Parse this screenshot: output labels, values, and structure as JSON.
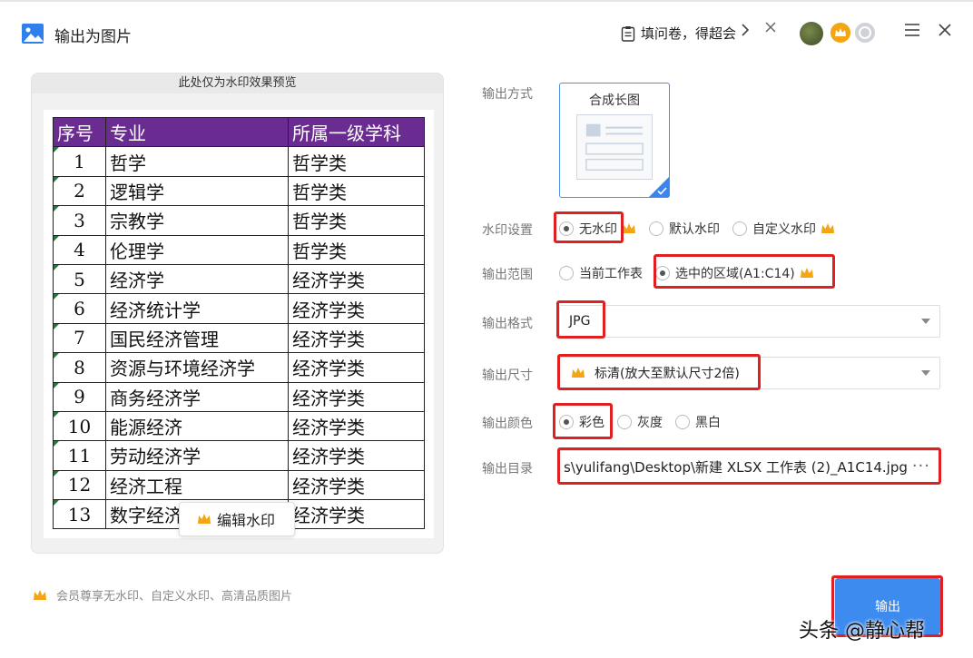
{
  "window": {
    "title": "输出为图片",
    "survey_label": "填问卷，得超会",
    "colors": {
      "accent": "#3e8bf0",
      "vip_gold": "#f3a514",
      "highlight": "#e02020",
      "table_header": "#6a2c91"
    }
  },
  "preview": {
    "header": "此处仅为水印效果预览",
    "table": {
      "headers": [
        "序号",
        "专业",
        "所属一级学科"
      ],
      "rows": [
        [
          "1",
          "哲学",
          "哲学类"
        ],
        [
          "2",
          "逻辑学",
          "哲学类"
        ],
        [
          "3",
          "宗教学",
          "哲学类"
        ],
        [
          "4",
          "伦理学",
          "哲学类"
        ],
        [
          "5",
          "经济学",
          "经济学类"
        ],
        [
          "6",
          "经济统计学",
          "经济学类"
        ],
        [
          "7",
          "国民经济管理",
          "经济学类"
        ],
        [
          "8",
          "资源与环境经济学",
          "经济学类"
        ],
        [
          "9",
          "商务经济学",
          "经济学类"
        ],
        [
          "10",
          "能源经济",
          "经济学类"
        ],
        [
          "11",
          "劳动经济学",
          "经济学类"
        ],
        [
          "12",
          "经济工程",
          "经济学类"
        ],
        [
          "13",
          "数字经济",
          "经济学类"
        ]
      ]
    },
    "edit_watermark_label": "编辑水印"
  },
  "settings": {
    "output_mode": {
      "label": "输出方式",
      "option": "合成长图"
    },
    "watermark": {
      "label": "水印设置",
      "options": [
        "无水印",
        "默认水印",
        "自定义水印"
      ],
      "selected": "无水印"
    },
    "range": {
      "label": "输出范围",
      "options": [
        "当前工作表",
        "选中的区域(A1:C14)"
      ],
      "selected": "选中的区域(A1:C14)"
    },
    "format": {
      "label": "输出格式",
      "value": "JPG"
    },
    "size": {
      "label": "输出尺寸",
      "value": "标清(放大至默认尺寸2倍)"
    },
    "color": {
      "label": "输出颜色",
      "options": [
        "彩色",
        "灰度",
        "黑白"
      ],
      "selected": "彩色"
    },
    "directory": {
      "label": "输出目录",
      "value": "s\\yulifang\\Desktop\\新建 XLSX 工作表 (2)_A1C14.jpg",
      "more": "···"
    }
  },
  "footer": {
    "member_note": "会员尊享无水印、自定义水印、高清品质图片",
    "export_label": "输出",
    "overlay_watermark": "头条 @静心帮"
  }
}
